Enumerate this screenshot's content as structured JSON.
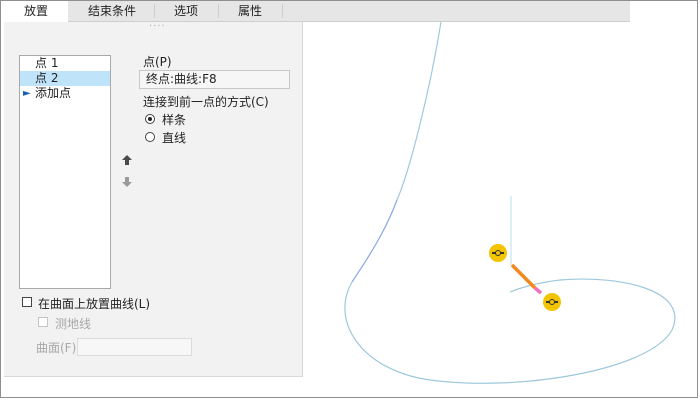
{
  "tabs": [
    {
      "label": "放置",
      "active": true
    },
    {
      "label": "结束条件",
      "active": false
    },
    {
      "label": "选项",
      "active": false
    },
    {
      "label": "属性",
      "active": false
    }
  ],
  "point_list": {
    "items": [
      "点 1",
      "点 2"
    ],
    "selected_index": 1,
    "add_label": "添加点"
  },
  "point_field": {
    "label": "点(P)",
    "value": "终点:曲线:F8"
  },
  "connect": {
    "label": "连接到前一点的方式(C)",
    "options": [
      {
        "label": "样条",
        "checked": true
      },
      {
        "label": "直线",
        "checked": false
      }
    ]
  },
  "on_surface": {
    "label": "在曲面上放置曲线(L)",
    "checked": false,
    "geodesic_label": "测地线",
    "surface_label": "曲面(F)"
  },
  "icons": {
    "move_up": "arrow-up-icon",
    "move_down": "arrow-down-icon",
    "add_point": "arrow-right-icon",
    "drag_handle": "drag-handle-icon"
  },
  "colors": {
    "selection": "#bfe3f8",
    "curve": "#9fc8dd",
    "curve_upper": "#8aa6e6",
    "tangent_orange": "#f08a1e",
    "tangent_pink": "#f36fc0",
    "handle": "#f5c400"
  }
}
